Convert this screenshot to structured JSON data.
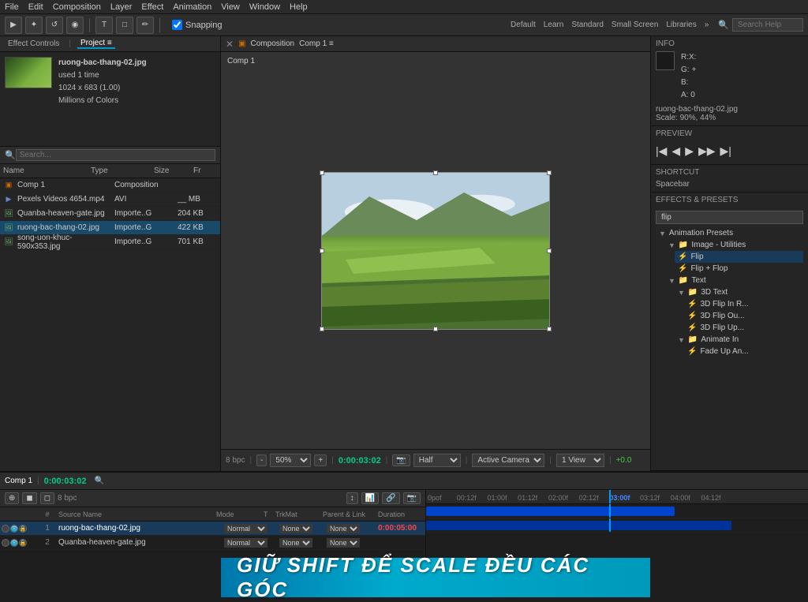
{
  "app": {
    "title": "Adobe After Effects"
  },
  "menubar": {
    "items": [
      "File",
      "Edit",
      "Composition",
      "Layer",
      "Effect",
      "Animation",
      "View",
      "Window",
      "Help"
    ]
  },
  "toolbar": {
    "snapping_label": "Snapping",
    "workspaces": [
      "Default",
      "Learn",
      "Standard",
      "Small Screen",
      "Libraries"
    ],
    "search_placeholder": "Search Help"
  },
  "panels": {
    "effect_controls_tab": "Effect Controls",
    "project_tab": "Project ≡",
    "file_name": "ruong-bac-thang-02.jpg",
    "file_used": "used 1 time",
    "file_dims": "1024 x 683 (1.00)",
    "file_color": "Millions of Colors",
    "project_items": [
      {
        "name": "Comp 1",
        "type": "Composition",
        "size": "",
        "fr": "",
        "icon": "comp"
      },
      {
        "name": "Pexels Videos 4654.mp4",
        "type": "AVI",
        "size": "__ MB",
        "fr": "",
        "icon": "video"
      },
      {
        "name": "Quanba-heaven-gate.jpg",
        "type": "Importe..G",
        "size": "204 KB",
        "fr": "",
        "icon": "img"
      },
      {
        "name": "ruong-bac-thang-02.jpg",
        "type": "Importe..G",
        "size": "422 KB",
        "fr": "",
        "icon": "img"
      },
      {
        "name": "song-uon-khuc-590x353.jpg",
        "type": "Importe..G",
        "size": "701 KB",
        "fr": "",
        "icon": "img"
      }
    ],
    "list_headers": {
      "name": "Name",
      "type": "Type",
      "size": "Size",
      "fr": "Fr"
    }
  },
  "comp": {
    "tab_label": "Composition",
    "comp_name": "Comp 1 ≡",
    "label": "Comp 1",
    "zoom": "50%",
    "timecode": "0:00:03:02",
    "quality": "Half",
    "view": "Active Camera",
    "views": "1 View"
  },
  "info_panel": {
    "title": "Info",
    "r_label": "R:",
    "r_val": "",
    "x_label": "X:",
    "x_val": "",
    "g_label": "G:",
    "g_val": "",
    "b_label": "B:",
    "b_val": "",
    "a_label": "A: 0",
    "file_ref": "ruong-bac-thang-02.jpg",
    "scale": "Scale: 90%, 44%",
    "preview_title": "Preview",
    "shortcut_title": "Shortcut",
    "spacebar": "Spacebar",
    "effects_title": "Effects & Presets",
    "effects_search": "flip",
    "tree": {
      "animation_presets": "Animation Presets",
      "image_utilities": "Image - Utilities",
      "flip": "Flip",
      "flip_flop": "Flip + Flop",
      "text": "Text",
      "3d_text": "3D Text",
      "3d_flip_in": "3D Flip In R...",
      "3d_flip_out": "3D Flip Ou...",
      "3d_flip_up": "3D Flip Up...",
      "animate_in": "Animate In",
      "fade_up_ani": "Fade Up An..."
    }
  },
  "timeline": {
    "comp_label": "Comp 1",
    "timecode": "0:00:03:02",
    "bpc": "8 bpc",
    "col_headers": {
      "switches": "",
      "num": "#",
      "source": "Source Name",
      "mode": "Mode",
      "t": "T",
      "trkmat": "TrkMat",
      "parent": "Parent & Link",
      "duration": "Duration"
    },
    "ruler_marks": [
      "0pof",
      "00:12f",
      "01:00f",
      "01:12f",
      "02:00f",
      "02:12f",
      "03:00f",
      "03:12f",
      "04:00f",
      "04:12f"
    ],
    "layers": [
      {
        "num": "1",
        "name": "ruong-bac-thang-02.jpg",
        "mode": "Normal",
        "t": "",
        "trkmat": "None",
        "parent": "None",
        "duration": "0:00:05:00",
        "selected": true
      },
      {
        "num": "2",
        "name": "Quanba-heaven-gate.jpg",
        "mode": "Normal",
        "t": "",
        "trkmat": "None",
        "parent": "",
        "duration": "",
        "selected": false
      }
    ]
  },
  "banner": {
    "text": "GIỮ SHIFT ĐỂ SCALE ĐỀU CÁC GÓC"
  }
}
